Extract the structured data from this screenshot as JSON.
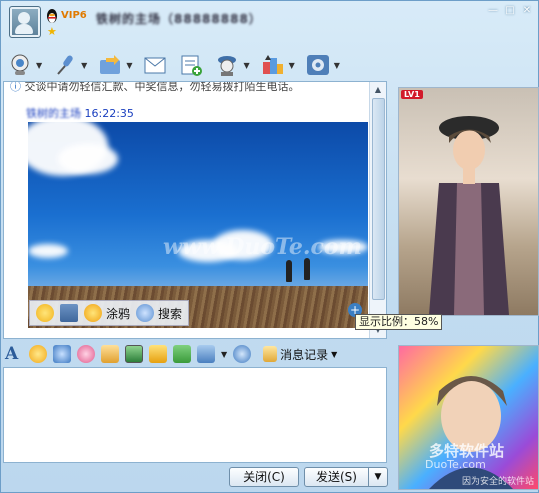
{
  "titlebar": {
    "vip_badge": "VIP6",
    "contact_name": "铁树的主场（88888888）",
    "window_buttons": [
      "minimize-icon",
      "maximize-icon",
      "close-icon"
    ]
  },
  "toolbar": {
    "items": [
      {
        "icon": "video-camera-icon"
      },
      {
        "icon": "microphone-icon"
      },
      {
        "icon": "send-file-icon"
      },
      {
        "icon": "email-icon"
      },
      {
        "icon": "create-group-icon"
      },
      {
        "icon": "remote-assist-icon"
      },
      {
        "icon": "apps-icon"
      },
      {
        "icon": "settings-icon"
      }
    ]
  },
  "chat": {
    "notice": "交谈中请勿轻信汇款、中奖信息，勿轻易拨打陌生电话。",
    "timestamp_name": "铁树的主场",
    "timestamp_time": "16:22:35",
    "photo_watermark": "www.DuoTe.com",
    "photo_toolbar": {
      "doodle_label": "涂鸦",
      "search_label": "搜索"
    },
    "zoom_tooltip": "显示比例：58%"
  },
  "formatbar": {
    "font_glyph": "A",
    "history_label": "消息记录"
  },
  "buttons": {
    "close_label": "关闭(C)",
    "send_label": "发送(S)"
  },
  "right_panel": {
    "level_badge": "LV1",
    "watermark_line1": "多特软件站",
    "watermark_line2": "DuoTe.com",
    "watermark_line3": "因为安全的软件站"
  }
}
